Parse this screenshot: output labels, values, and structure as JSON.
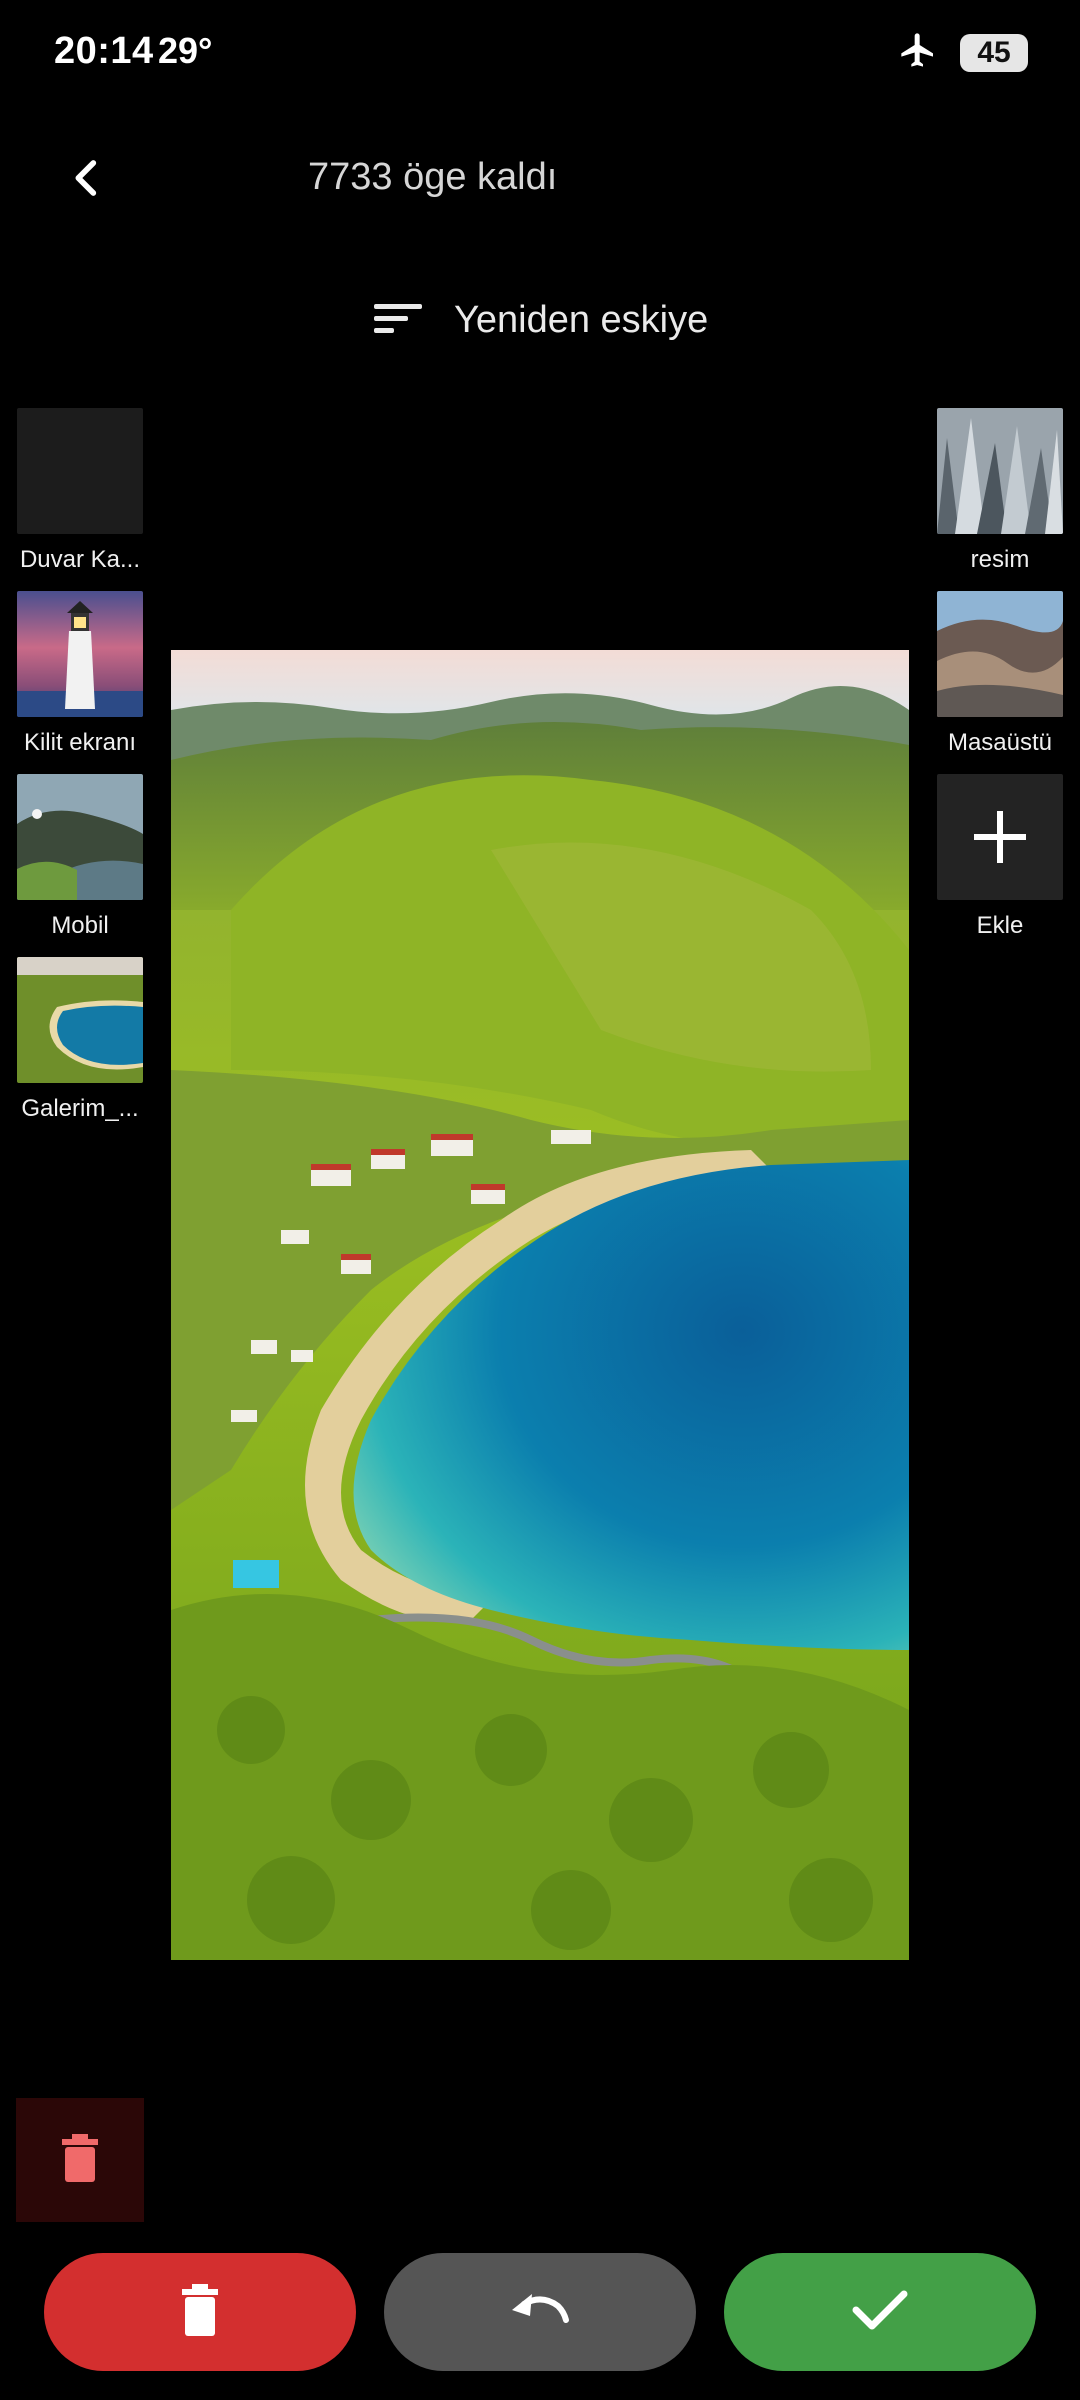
{
  "status_bar": {
    "time": "20:14",
    "temperature": "29°",
    "battery": "45",
    "airplane_icon": "airplane-icon"
  },
  "header": {
    "back_icon": "back-arrow-icon",
    "title": "7733 öge kaldı"
  },
  "sort": {
    "icon": "sort-icon",
    "label": "Yeniden eskiye"
  },
  "left_folders": [
    {
      "label": "Duvar Ka..."
    },
    {
      "label": "Kilit ekranı"
    },
    {
      "label": "Mobil"
    },
    {
      "label": "Galerim_..."
    }
  ],
  "right_folders": [
    {
      "label": "resim"
    },
    {
      "label": "Masaüstü"
    },
    {
      "label": "Ekle"
    }
  ],
  "actions": {
    "delete_icon": "trash-icon",
    "undo_icon": "undo-icon",
    "keep_icon": "check-icon",
    "trash_bin_icon": "trash-icon"
  },
  "colors": {
    "delete": "#d32f2f",
    "undo": "#555555",
    "keep": "#43a047",
    "trash_bin_bg": "#2b0707"
  }
}
